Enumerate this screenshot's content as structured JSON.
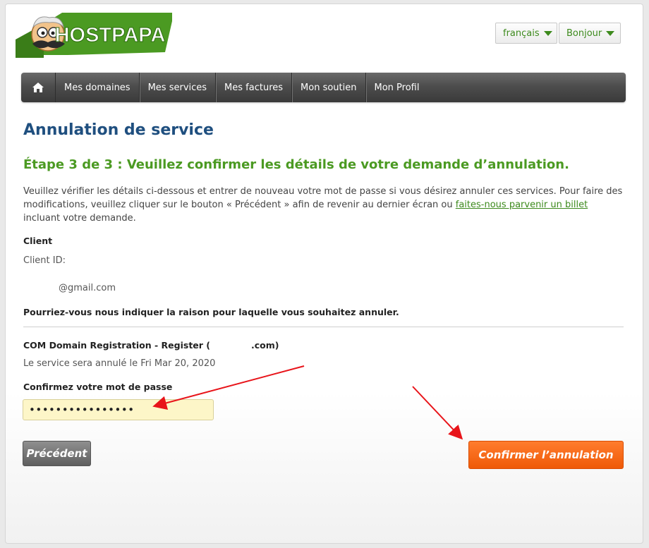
{
  "header": {
    "brand": "HOSTPAPA",
    "language_label": "français",
    "user_label": "Bonjour"
  },
  "nav": {
    "home_icon": "home-icon",
    "items": [
      "Mes domaines",
      "Mes services",
      "Mes factures",
      "Mon soutien",
      "Mon Profil"
    ]
  },
  "page": {
    "title": "Annulation de service",
    "step": "Étape 3 de 3 : Veuillez confirmer les détails de votre demande d’annulation.",
    "intro_text": "Veuillez vérifier les détails ci-dessous et entrer de nouveau votre mot de passe si vous désirez annuler ces services. Pour faire des modifications, veuillez cliquer sur le bouton « Précédent » afin de revenir au dernier écran ou ",
    "intro_link": "faites-nous parvenir un billet",
    "intro_suffix": " incluant votre demande."
  },
  "client": {
    "heading": "Client",
    "id_label": "Client ID:",
    "email": "@gmail.com",
    "reason_prompt": "Pourriez-vous nous indiquer la raison pour laquelle vous souhaitez annuler."
  },
  "service": {
    "name": "COM Domain Registration - Register (",
    "name_suffix": ".com)",
    "cancel_notice": "Le service sera annulé le Fri Mar 20, 2020"
  },
  "password": {
    "label": "Confirmez votre mot de passe",
    "value": "••••••••••••••••"
  },
  "buttons": {
    "previous": "Précédent",
    "confirm": "Confirmer l’annulation"
  },
  "colors": {
    "brand_green": "#4b9a22",
    "title_blue": "#1f4f7f",
    "confirm_orange": "#f06010",
    "annotation_red": "#e8141a"
  }
}
